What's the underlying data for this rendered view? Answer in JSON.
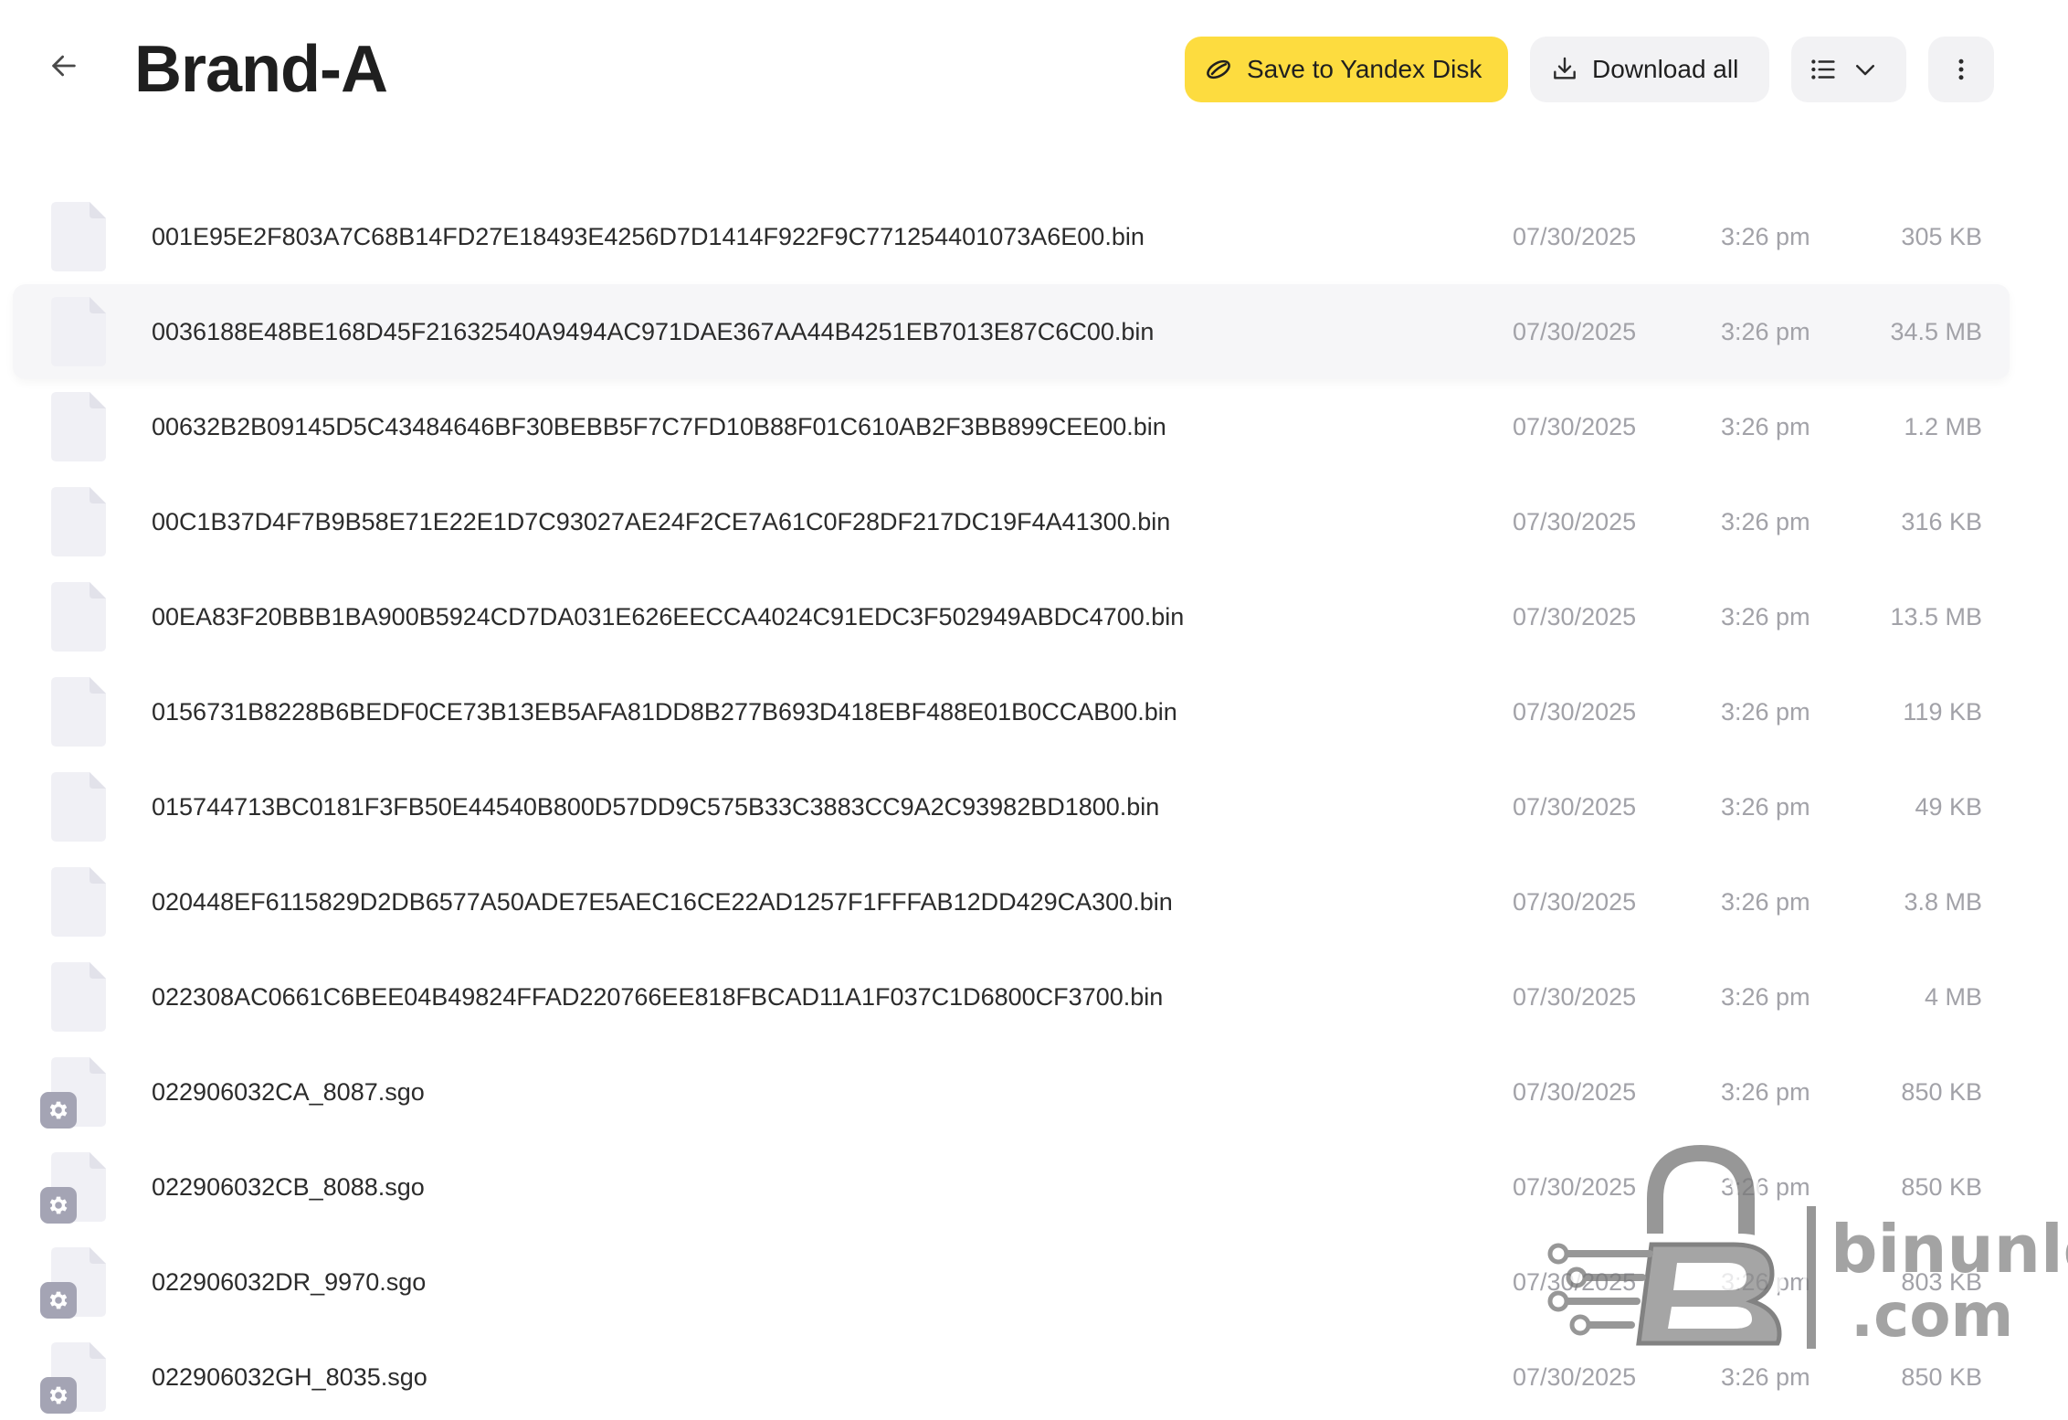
{
  "header": {
    "title": "Brand-A",
    "back_icon": "arrow-left-icon",
    "save_label": "Save to Yandex Disk",
    "download_label": "Download all",
    "view_icon": "list-view-icon",
    "more_icon": "vertical-dots-icon"
  },
  "colors": {
    "accent": "#fddc3f",
    "button_bg": "#f2f2f4",
    "meta_text": "#a2a2a8",
    "file_icon": "#f0f0f5",
    "settings_badge": "#a4a4b4"
  },
  "files": [
    {
      "name": "001E95E2F803A7C68B14FD27E18493E4256D7D1414F922F9C771254401073A6E00.bin",
      "date": "07/30/2025",
      "time": "3:26 pm",
      "size": "305 KB",
      "type": "bin"
    },
    {
      "name": "0036188E48BE168D45F21632540A9494AC971DAE367AA44B4251EB7013E87C6C00.bin",
      "date": "07/30/2025",
      "time": "3:26 pm",
      "size": "34.5 MB",
      "type": "bin"
    },
    {
      "name": "00632B2B09145D5C43484646BF30BEBB5F7C7FD10B88F01C610AB2F3BB899CEE00.bin",
      "date": "07/30/2025",
      "time": "3:26 pm",
      "size": "1.2 MB",
      "type": "bin"
    },
    {
      "name": "00C1B37D4F7B9B58E71E22E1D7C93027AE24F2CE7A61C0F28DF217DC19F4A41300.bin",
      "date": "07/30/2025",
      "time": "3:26 pm",
      "size": "316 KB",
      "type": "bin"
    },
    {
      "name": "00EA83F20BBB1BA900B5924CD7DA031E626EECCA4024C91EDC3F502949ABDC4700.bin",
      "date": "07/30/2025",
      "time": "3:26 pm",
      "size": "13.5 MB",
      "type": "bin"
    },
    {
      "name": "0156731B8228B6BEDF0CE73B13EB5AFA81DD8B277B693D418EBF488E01B0CCAB00.bin",
      "date": "07/30/2025",
      "time": "3:26 pm",
      "size": "119 KB",
      "type": "bin"
    },
    {
      "name": "015744713BC0181F3FB50E44540B800D57DD9C575B33C3883CC9A2C93982BD1800.bin",
      "date": "07/30/2025",
      "time": "3:26 pm",
      "size": "49 KB",
      "type": "bin"
    },
    {
      "name": "020448EF6115829D2DB6577A50ADE7E5AEC16CE22AD1257F1FFFAB12DD429CA300.bin",
      "date": "07/30/2025",
      "time": "3:26 pm",
      "size": "3.8 MB",
      "type": "bin"
    },
    {
      "name": "022308AC0661C6BEE04B49824FFAD220766EE818FBCAD11A1F037C1D6800CF3700.bin",
      "date": "07/30/2025",
      "time": "3:26 pm",
      "size": "4 MB",
      "type": "bin"
    },
    {
      "name": "022906032CA_8087.sgo",
      "date": "07/30/2025",
      "time": "3:26 pm",
      "size": "850 KB",
      "type": "sgo"
    },
    {
      "name": "022906032CB_8088.sgo",
      "date": "07/30/2025",
      "time": "3:26 pm",
      "size": "850 KB",
      "type": "sgo"
    },
    {
      "name": "022906032DR_9970.sgo",
      "date": "07/30/2025",
      "time": "3:26 pm",
      "size": "803 KB",
      "type": "sgo"
    },
    {
      "name": "022906032GH_8035.sgo",
      "date": "07/30/2025",
      "time": "3:26 pm",
      "size": "850 KB",
      "type": "sgo"
    }
  ],
  "hovered_row": 1,
  "watermark": {
    "line1": "binunlock",
    "line2": ".com"
  }
}
